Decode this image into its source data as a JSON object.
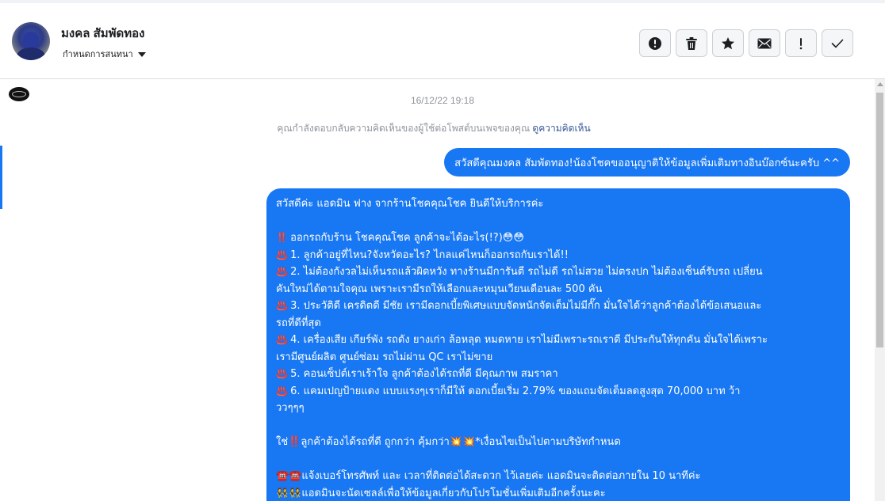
{
  "header": {
    "contact_name": "มงคล สัมพัดทอง",
    "assign_label": "กำหนดการสนทนา",
    "actions": [
      {
        "name": "report-button",
        "icon": "exclamation-circle-icon"
      },
      {
        "name": "delete-button",
        "icon": "trash-icon"
      },
      {
        "name": "star-button",
        "icon": "star-icon"
      },
      {
        "name": "mark-unread-button",
        "icon": "envelope-icon"
      },
      {
        "name": "follow-up-button",
        "icon": "exclamation-icon"
      },
      {
        "name": "mark-done-button",
        "icon": "check-icon"
      }
    ]
  },
  "thread": {
    "timestamp": "16/12/22 19:18",
    "context_note": "คุณกำลังตอบกลับความคิดเห็นของผู้ใช้ต่อโพสต์บนเพจของคุณ ",
    "context_link": "ดูความคิดเห็น",
    "outgoing_short": "สวัสดีคุณมงคล สัมพัดทอง!น้องโชคขออนุญาติให้ข้อมูลเพิ่มเติมทางอินบ๊อกซ์นะครับ ^^",
    "outgoing_long": {
      "lines": [
        {
          "emoji": "",
          "text": "สวัสดีค่ะ แอดมิน ฟาง จากร้านโชคคุณโชค ยินดีให้บริการค่ะ"
        },
        {
          "emoji": "",
          "text": ""
        },
        {
          "emoji": "‼️",
          "text": "ออกรถกับร้าน โชคคุณโชค ลูกค้าจะได้อะไร(!?)😳😳"
        },
        {
          "emoji": "♨️",
          "text": "1. ลูกค้าอยู่ที่ไหน?จังหวัดอะไร? ไกลแค่ไหนก็ออกรถกับเราได้!!"
        },
        {
          "emoji": "♨️",
          "text": "2. ไม่ต้องกังวลไม่เห็นรถแล้วผิดหวัง ทางร้านมีการันตี รถไม่ดี รถไม่สวย ไม่ตรงปก ไม่ต้องเซ็นต์รับรถ เปลี่ยน"
        },
        {
          "emoji": "",
          "text": "คันใหม่ได้ตามใจคุณ เพราะเรามีรถให้เลือกและหมุนเวียนเดือนละ 500 คัน"
        },
        {
          "emoji": "♨️",
          "text": "3. ประวัติดี เครดิตดี มีชัย เรามีดอกเบี้ยพิเศษแบบจัดหนักจัดเต็มไม่มีกั๊ก มั่นใจได้ว่าลูกค้าต้องได้ข้อเสนอและ"
        },
        {
          "emoji": "",
          "text": "รถที่ดีที่สุด"
        },
        {
          "emoji": "♨️",
          "text": "4. เครื่องเสีย เกียร์พัง รถดัง ยางเก่า ล้อหลุด หมดหาย เราไม่มีเพราะรถเราดี มีประกันให้ทุกคัน มั่นใจได้เพราะ"
        },
        {
          "emoji": "",
          "text": "เรามีศูนย์ผลิต ศูนย์ซ่อม รถไม่ผ่าน QC เราไม่ขาย"
        },
        {
          "emoji": "♨️",
          "text": "5. คอนเซ็ปต์เราเร้าใจ ลูกค้าต้องได้รถที่ดี มีคุณภาพ สมราคา"
        },
        {
          "emoji": "♨️",
          "text": "6. แคมเปญป้ายแดง แบบแรงๆเราก็มีให้ ดอกเบี้ยเริ่ม 2.79%  ของแถมจัดเต็มลดสูงสุด 70,000 บาท  ว้า"
        },
        {
          "emoji": "",
          "text": "ววๆๆๆ"
        },
        {
          "emoji": "",
          "text": ""
        },
        {
          "emoji": "",
          "text": "ใช่‼️ลูกค้าต้องได้รถที่ดี ถูกกว่า คุ้มกว่า💥💥*เงื่อนไขเป็นไปตามบริษัทกำหนด"
        },
        {
          "emoji": "",
          "text": ""
        },
        {
          "emoji": "",
          "text": "☎️☎️แจ้งเบอร์โทรศัพท์ และ เวลาที่ติดต่อได้สะดวก ไว้เลยค่ะ แอดมินจะติดต่อภายใน 10 นาทีค่ะ"
        },
        {
          "emoji": "",
          "text": "👯👯แอดมินจะนัดเซลล์เพื่อให้ข้อมูลเกี่ยวกับโปรโมชั่นเพิ่มเติมอีกครั้งนะคะ"
        }
      ]
    }
  },
  "colors": {
    "bubble": "#1877f2",
    "muted_text": "#90949c",
    "link": "#385898"
  }
}
